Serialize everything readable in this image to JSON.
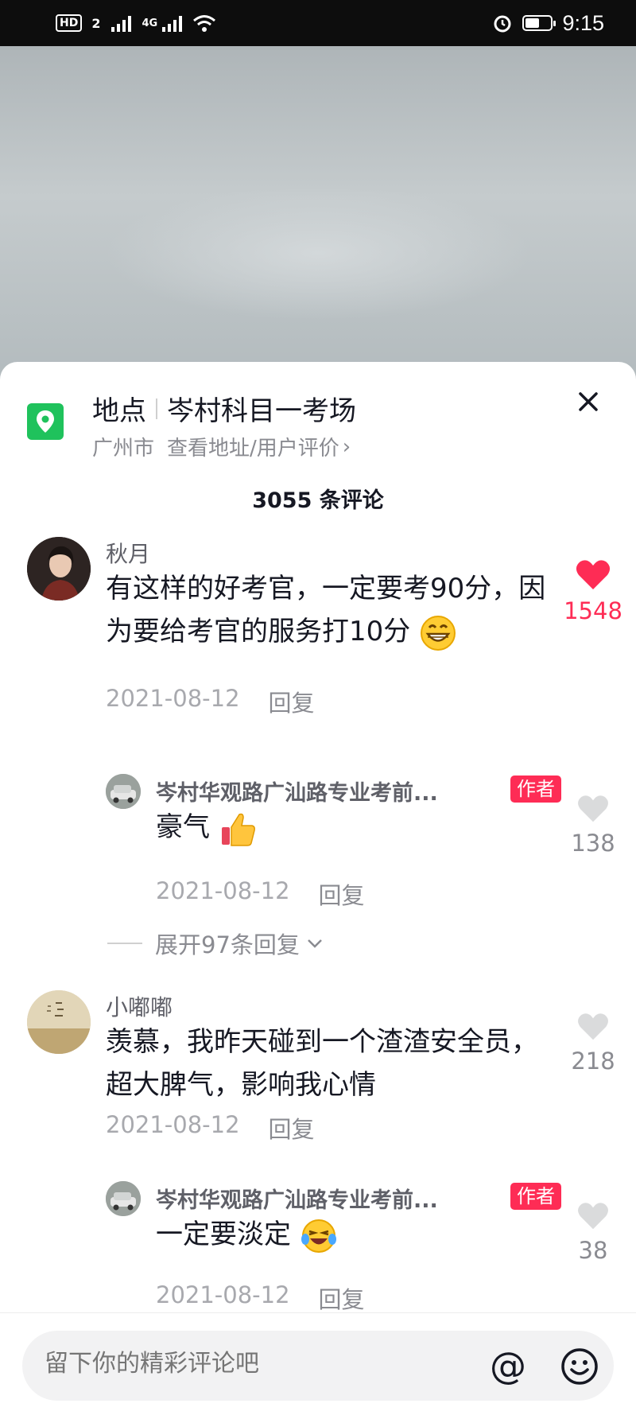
{
  "status_bar": {
    "network_badge": "HD",
    "sim": "2",
    "net_type": "4G",
    "time": "9:15"
  },
  "location": {
    "label": "地点",
    "name": "岑村科目一考场",
    "city": "广州市",
    "link": "查看地址/用户评价"
  },
  "comment_count": "3055 条评论",
  "comments": [
    {
      "user": "秋月",
      "text": "有这样的好考官，一定要考90分，因为要给考官的服务打10分",
      "emoji": "grinning-face",
      "date": "2021-08-12",
      "reply_label": "回复",
      "likes": "1548",
      "liked": true,
      "replies": [
        {
          "user": "岑村华观路广汕路专业考前...",
          "badge": "作者",
          "text": "豪气",
          "emoji": "thumbs-up",
          "date": "2021-08-12",
          "reply_label": "回复",
          "likes": "138"
        }
      ],
      "expand_label": "展开97条回复"
    },
    {
      "user": "小嘟嘟",
      "text": "羡慕，我昨天碰到一个渣渣安全员，超大脾气，影响我心情",
      "date": "2021-08-12",
      "reply_label": "回复",
      "likes": "218",
      "liked": false,
      "replies": [
        {
          "user": "岑村华观路广汕路专业考前...",
          "badge": "作者",
          "text": "一定要淡定",
          "emoji": "laughing-tears",
          "date": "2021-08-12",
          "reply_label": "回复",
          "likes": "38"
        }
      ]
    }
  ],
  "input": {
    "placeholder": "留下你的精彩评论吧",
    "at_symbol": "@"
  },
  "colors": {
    "accent": "#fe2c55",
    "location_pin": "#1fc25c",
    "text_primary": "#161823",
    "text_secondary": "#a8a9ae"
  }
}
